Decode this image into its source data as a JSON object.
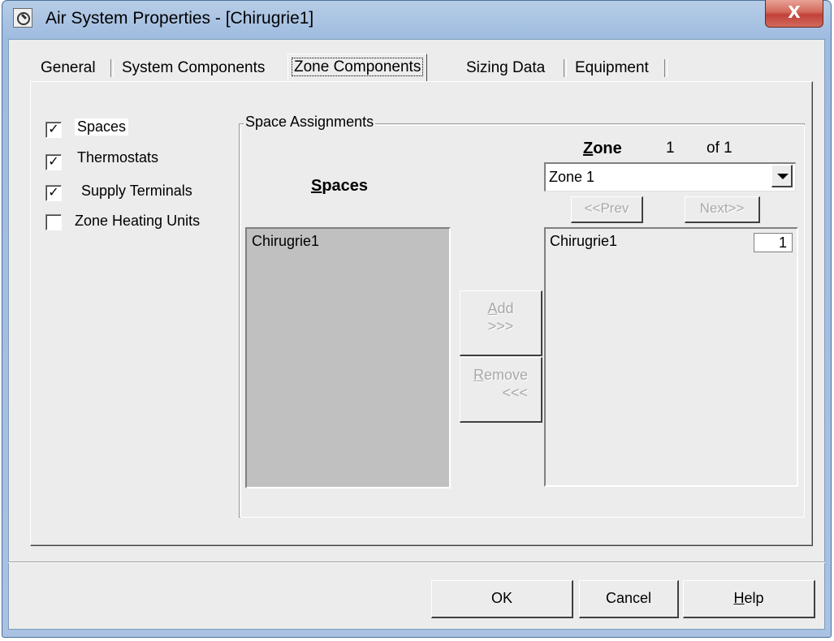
{
  "window": {
    "title": "Air System Properties - [Chirugrie1]",
    "close_label": "X"
  },
  "tabs": [
    {
      "label": "General"
    },
    {
      "label": "System Components"
    },
    {
      "label": "Zone Components"
    },
    {
      "label": "Sizing Data"
    },
    {
      "label": "Equipment"
    }
  ],
  "components": {
    "items": [
      {
        "label": "Spaces",
        "checked": true,
        "mark": "✓"
      },
      {
        "label": "Thermostats",
        "checked": true,
        "mark": "✓"
      },
      {
        "label": "Supply Terminals",
        "checked": true,
        "mark": "✓"
      },
      {
        "label": "Zone Heating Units",
        "checked": false,
        "mark": ""
      }
    ]
  },
  "space_assignments": {
    "group_title": "Space Assignments",
    "spaces_header_s": "S",
    "spaces_header_rest": "paces",
    "spaces_list": [
      "Chirugrie1"
    ],
    "zone_label_z": "Z",
    "zone_label_rest": "one",
    "zone_index": "1",
    "zone_of": "of 1",
    "zone_selected": "Zone 1",
    "prev_label": "<<Prev",
    "next_label": "Next>>",
    "add_label_a": "A",
    "add_label_rest": "dd",
    "add_arrows": ">>>",
    "remove_label_r": "R",
    "remove_label_rest": "emove",
    "remove_arrows": "<<<",
    "zone_list": [
      {
        "name": "Chirugrie1",
        "count": "1"
      }
    ]
  },
  "footer": {
    "ok_label": "OK",
    "cancel_label": "Cancel",
    "help_label_h": "H",
    "help_label_rest": "elp"
  }
}
